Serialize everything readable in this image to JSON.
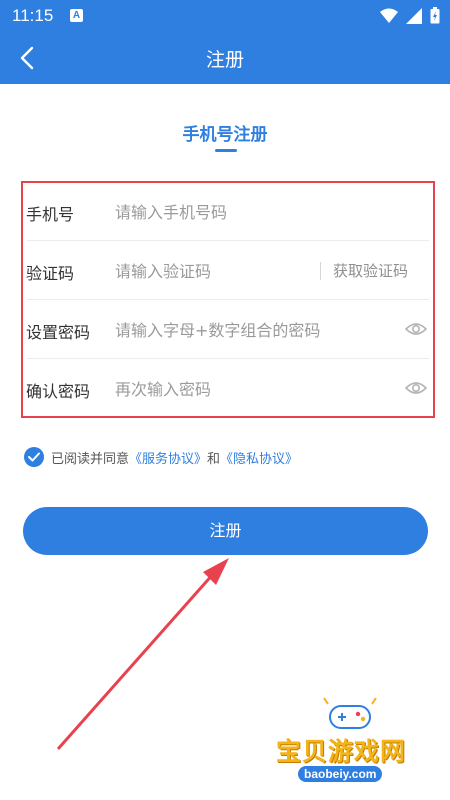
{
  "status_bar": {
    "time": "11:15",
    "notification_letter": "A"
  },
  "nav": {
    "title": "注册"
  },
  "tab": {
    "title": "手机号注册"
  },
  "form": {
    "phone": {
      "label": "手机号",
      "placeholder": "请输入手机号码"
    },
    "code": {
      "label": "验证码",
      "placeholder": "请输入验证码",
      "button": "获取验证码"
    },
    "password": {
      "label": "设置密码",
      "placeholder": "请输入字母+数字组合的密码"
    },
    "confirm": {
      "label": "确认密码",
      "placeholder": "再次输入密码"
    }
  },
  "agreement": {
    "prefix": "已阅读并同意",
    "service_link": "《服务协议》",
    "and": "和",
    "privacy_link": "《隐私协议》",
    "checked": true
  },
  "register_button": "注册",
  "watermark": {
    "title": "宝贝游戏网",
    "site": "baobeiy.com"
  },
  "colors": {
    "primary": "#2f7fe0",
    "highlight_border": "#e8424e",
    "annotation_arrow": "#e8424e"
  }
}
